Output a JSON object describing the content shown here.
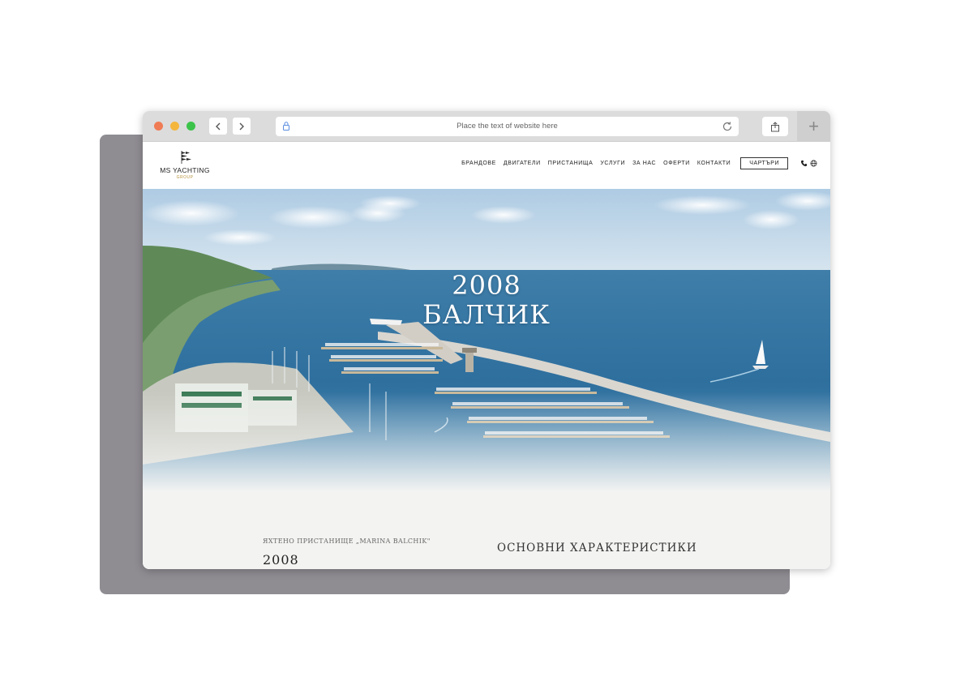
{
  "browser": {
    "url_placeholder": "Place the text of website here",
    "back_label": "‹",
    "forward_label": "›",
    "new_tab_label": "+"
  },
  "site": {
    "logo_text": "MS YACHTING",
    "logo_sub": "GROUP",
    "menu": [
      "БРАНДОВЕ",
      "ДВИГАТЕЛИ",
      "ПРИСТАНИЩА",
      "УСЛУГИ",
      "ЗА НАС",
      "ОФЕРТИ",
      "КОНТАКТИ"
    ],
    "cta": "ЧАРТЪРИ",
    "icons": [
      "phone-icon",
      "globe-icon"
    ]
  },
  "hero": {
    "year": "2008",
    "city": "БАЛЧИК"
  },
  "section": {
    "label": "ЯХТЕНО ПРИСТАНИЩЕ „MARINA BALCHIK\"",
    "year": "2008",
    "characteristics_title": "ОСНОВНИ ХАРАКТЕРИСТИКИ"
  },
  "colors": {
    "backdrop": "#8f8c92",
    "accent_gold": "#b8943e",
    "sea": "#2e6f9e"
  }
}
